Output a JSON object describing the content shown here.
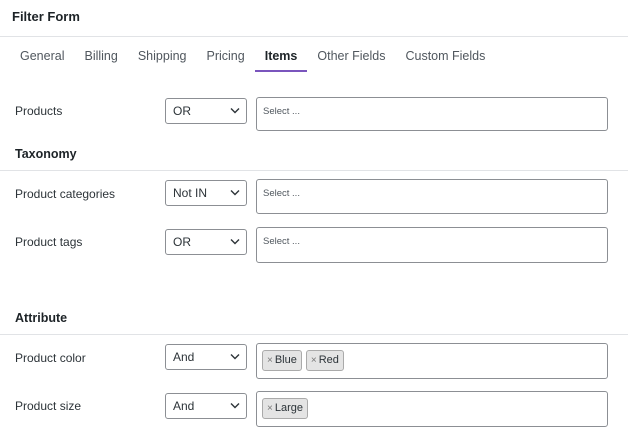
{
  "form": {
    "title": "Filter Form"
  },
  "tabs": [
    {
      "label": "General"
    },
    {
      "label": "Billing"
    },
    {
      "label": "Shipping"
    },
    {
      "label": "Pricing"
    },
    {
      "label": "Items",
      "active": true
    },
    {
      "label": "Other Fields"
    },
    {
      "label": "Custom Fields"
    }
  ],
  "items": {
    "products": {
      "label": "Products",
      "operator": "OR",
      "placeholder": "Select ..."
    }
  },
  "taxonomy": {
    "heading": "Taxonomy",
    "categories": {
      "label": "Product categories",
      "operator": "Not IN",
      "placeholder": "Select ..."
    },
    "tags": {
      "label": "Product tags",
      "operator": "OR",
      "placeholder": "Select ..."
    }
  },
  "attribute": {
    "heading": "Attribute",
    "color": {
      "label": "Product color",
      "operator": "And",
      "values": [
        "Blue",
        "Red"
      ]
    },
    "size": {
      "label": "Product size",
      "operator": "And",
      "values": [
        "Large"
      ]
    }
  },
  "colors": {
    "tab_active_underline": "#7a55bd",
    "border": "#8c8f94"
  },
  "icons": {
    "dropdown": "chevron-down-icon",
    "remove_tag": "close-icon"
  }
}
